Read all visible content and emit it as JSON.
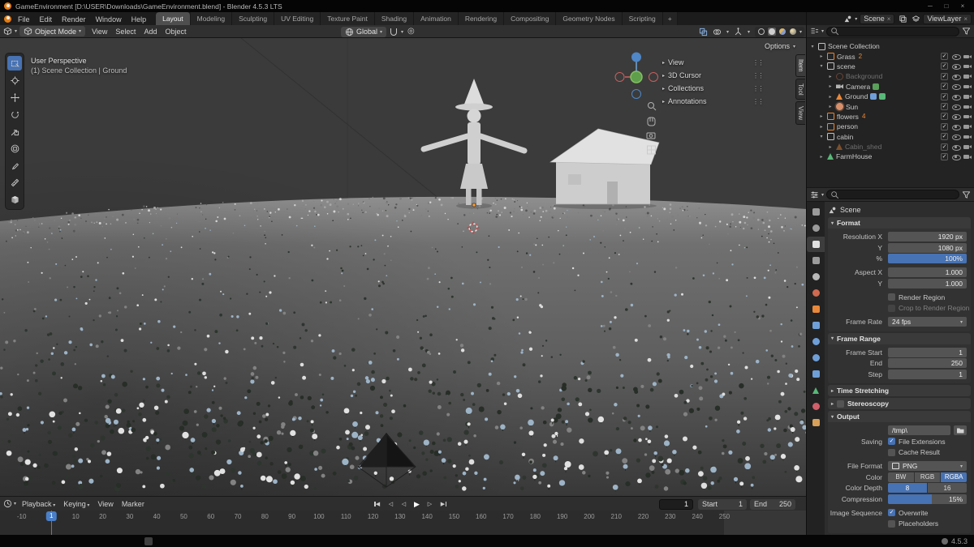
{
  "titlebar": {
    "title": "GameEnvironment [D:\\USER\\Downloads\\GameEnvironment.blend] - Blender 4.5.3 LTS"
  },
  "icons": {
    "minimize": "─",
    "maximize": "□",
    "close": "×",
    "caret_down": "▾",
    "caret_right": "▸",
    "check": "✓",
    "remove_x": "×",
    "proportional": "◎",
    "drag_handle": "⋮⋮"
  },
  "topbar": {
    "menus": [
      "File",
      "Edit",
      "Render",
      "Window",
      "Help"
    ],
    "workspaces": [
      "Layout",
      "Modeling",
      "Sculpting",
      "UV Editing",
      "Texture Paint",
      "Shading",
      "Animation",
      "Rendering",
      "Compositing",
      "Geometry Nodes",
      "Scripting"
    ],
    "active_workspace": "Layout",
    "add_workspace": "+",
    "scene_name": "Scene",
    "viewlayer_name": "ViewLayer"
  },
  "viewport_header": {
    "mode": "Object Mode",
    "menus": [
      "View",
      "Select",
      "Add",
      "Object"
    ],
    "orientation": "Global",
    "options_label": "Options"
  },
  "viewport": {
    "projection_label": "User Perspective",
    "context_label": "(1) Scene Collection | Ground",
    "sidebar_sections": [
      "View",
      "3D Cursor",
      "Collections",
      "Annotations"
    ],
    "sidebar_tabs": [
      "Item",
      "Tool",
      "View"
    ]
  },
  "toolbar": {
    "tools": [
      "select-box",
      "cursor",
      "move",
      "rotate",
      "scale",
      "transform",
      "annotate",
      "measure",
      "add-cube"
    ],
    "active_tool": "select-box"
  },
  "outliner": {
    "search_placeholder": "",
    "rows": [
      {
        "depth": 0,
        "open": true,
        "icon": "collection",
        "label": "Scene Collection",
        "toggles": false
      },
      {
        "depth": 1,
        "open": false,
        "icon": "collection-orange",
        "label": "Grass",
        "badge": "2",
        "toggles": true
      },
      {
        "depth": 1,
        "open": true,
        "icon": "collection",
        "label": "scene",
        "toggles": true
      },
      {
        "depth": 2,
        "open": false,
        "icon": "world",
        "label": "Background",
        "dim": true,
        "toggles": true
      },
      {
        "depth": 2,
        "open": false,
        "icon": "camera",
        "label": "Camera",
        "extras": [
          "active-cam"
        ],
        "toggles": true
      },
      {
        "depth": 2,
        "open": false,
        "icon": "mesh",
        "label": "Ground",
        "extras": [
          "modifier",
          "data"
        ],
        "toggles": true
      },
      {
        "depth": 2,
        "open": false,
        "icon": "light",
        "label": "Sun",
        "toggles": true
      },
      {
        "depth": 1,
        "open": false,
        "icon": "collection-orange",
        "label": "flowers",
        "badge": "4",
        "toggles": true
      },
      {
        "depth": 1,
        "open": false,
        "icon": "collection-orange",
        "label": "person",
        "toggles": true
      },
      {
        "depth": 1,
        "open": true,
        "icon": "collection",
        "label": "cabin",
        "toggles": true
      },
      {
        "depth": 2,
        "open": false,
        "icon": "mesh",
        "label": "Cabin_shed",
        "dim": true,
        "toggles": true
      },
      {
        "depth": 1,
        "open": false,
        "icon": "mesh-green",
        "label": "FarmHouse",
        "toggles": true
      }
    ]
  },
  "properties": {
    "breadcrumb": "Scene",
    "search_placeholder": "",
    "tabs": [
      {
        "name": "tool",
        "color": "#9b9b9b",
        "shape": "sq"
      },
      {
        "name": "render",
        "color": "#9b9b9b",
        "shape": "c"
      },
      {
        "name": "output",
        "color": "#e2e2e2",
        "shape": "sq",
        "active": true
      },
      {
        "name": "view-layer",
        "color": "#9b9b9b",
        "shape": "sq"
      },
      {
        "name": "scene",
        "color": "#b8b8b8",
        "shape": "c"
      },
      {
        "name": "world",
        "color": "#cf6a50",
        "shape": "c"
      },
      {
        "name": "object",
        "color": "#e8883a",
        "shape": "sq"
      },
      {
        "name": "modifiers",
        "color": "#6f9fd8",
        "shape": "sq"
      },
      {
        "name": "particles",
        "color": "#6f9fd8",
        "shape": "c"
      },
      {
        "name": "physics",
        "color": "#6f9fd8",
        "shape": "c"
      },
      {
        "name": "constraints",
        "color": "#6f9fd8",
        "shape": "sq"
      },
      {
        "name": "object-data",
        "color": "#58b878",
        "shape": "tri"
      },
      {
        "name": "material",
        "color": "#cf5f6a",
        "shape": "c"
      },
      {
        "name": "texture",
        "color": "#d8a058",
        "shape": "sq"
      }
    ],
    "sections": [
      {
        "title": "Format",
        "state": "open",
        "rows": [
          {
            "t": "field",
            "label": "Resolution X",
            "value": "1920 px"
          },
          {
            "t": "field",
            "label": "Y",
            "value": "1080 px"
          },
          {
            "t": "slider",
            "label": "%",
            "value": "100%",
            "fill": 100
          },
          {
            "t": "field",
            "label": "Aspect X",
            "value": "1.000",
            "gap": true
          },
          {
            "t": "field",
            "label": "Y",
            "value": "1.000"
          },
          {
            "t": "check",
            "label": "",
            "check": "Render Region",
            "checked": false,
            "gap": true
          },
          {
            "t": "check",
            "label": "",
            "check": "Crop to Render Region",
            "checked": false,
            "dim": true
          },
          {
            "t": "dropdown",
            "label": "Frame Rate",
            "value": "24 fps",
            "gap": true
          }
        ]
      },
      {
        "title": "Frame Range",
        "state": "open",
        "rows": [
          {
            "t": "field",
            "label": "Frame Start",
            "value": "1"
          },
          {
            "t": "field",
            "label": "End",
            "value": "250"
          },
          {
            "t": "field",
            "label": "Step",
            "value": "1"
          }
        ]
      },
      {
        "title": "Time Stretching",
        "state": "closed"
      },
      {
        "title": "Stereoscopy",
        "state": "closed",
        "checkbox": true
      },
      {
        "title": "Output",
        "state": "open",
        "rows": [
          {
            "t": "path",
            "label": "",
            "value": "/tmp\\"
          },
          {
            "t": "check",
            "label": "Saving",
            "check": "File Extensions",
            "checked": true
          },
          {
            "t": "check",
            "label": "",
            "check": "Cache Result",
            "checked": false
          },
          {
            "t": "dropdown",
            "label": "File Format",
            "value": "PNG",
            "img": true,
            "gap": true
          },
          {
            "t": "segment",
            "label": "Color",
            "options": [
              "BW",
              "RGB",
              "RGBA"
            ],
            "active": 2
          },
          {
            "t": "segment",
            "label": "Color Depth",
            "options": [
              "8",
              "16"
            ],
            "active": 0
          },
          {
            "t": "slider",
            "label": "Compression",
            "value": "15%",
            "fill": 56
          },
          {
            "t": "check",
            "label": "Image Sequence",
            "check": "Overwrite",
            "checked": true,
            "gap": true
          },
          {
            "t": "check",
            "label": "",
            "check": "Placeholders",
            "checked": false
          }
        ]
      }
    ]
  },
  "timeline": {
    "menus": [
      {
        "label": "Playback",
        "caret": true
      },
      {
        "label": "Keying",
        "caret": true
      },
      {
        "label": "View",
        "caret": false
      },
      {
        "label": "Marker",
        "caret": false
      }
    ],
    "transport": [
      {
        "name": "jump-to-start",
        "glyph": "◀",
        "bar": "l"
      },
      {
        "name": "prev-keyframe",
        "glyph": "◁"
      },
      {
        "name": "play-reverse",
        "glyph": "◁"
      },
      {
        "name": "play",
        "glyph": "▶",
        "big": true
      },
      {
        "name": "next-keyframe",
        "glyph": "▷"
      },
      {
        "name": "jump-to-end",
        "glyph": "▶",
        "bar": "r"
      }
    ],
    "current_frame": "1",
    "start_label": "Start",
    "start_value": "1",
    "end_label": "End",
    "end_value": "250",
    "ticks": [
      -10,
      0,
      10,
      20,
      30,
      40,
      50,
      60,
      70,
      80,
      90,
      100,
      110,
      120,
      130,
      140,
      150,
      160,
      170,
      180,
      190,
      200,
      210,
      220,
      230,
      240,
      250
    ]
  },
  "statusbar": {
    "version": "4.5.3"
  }
}
